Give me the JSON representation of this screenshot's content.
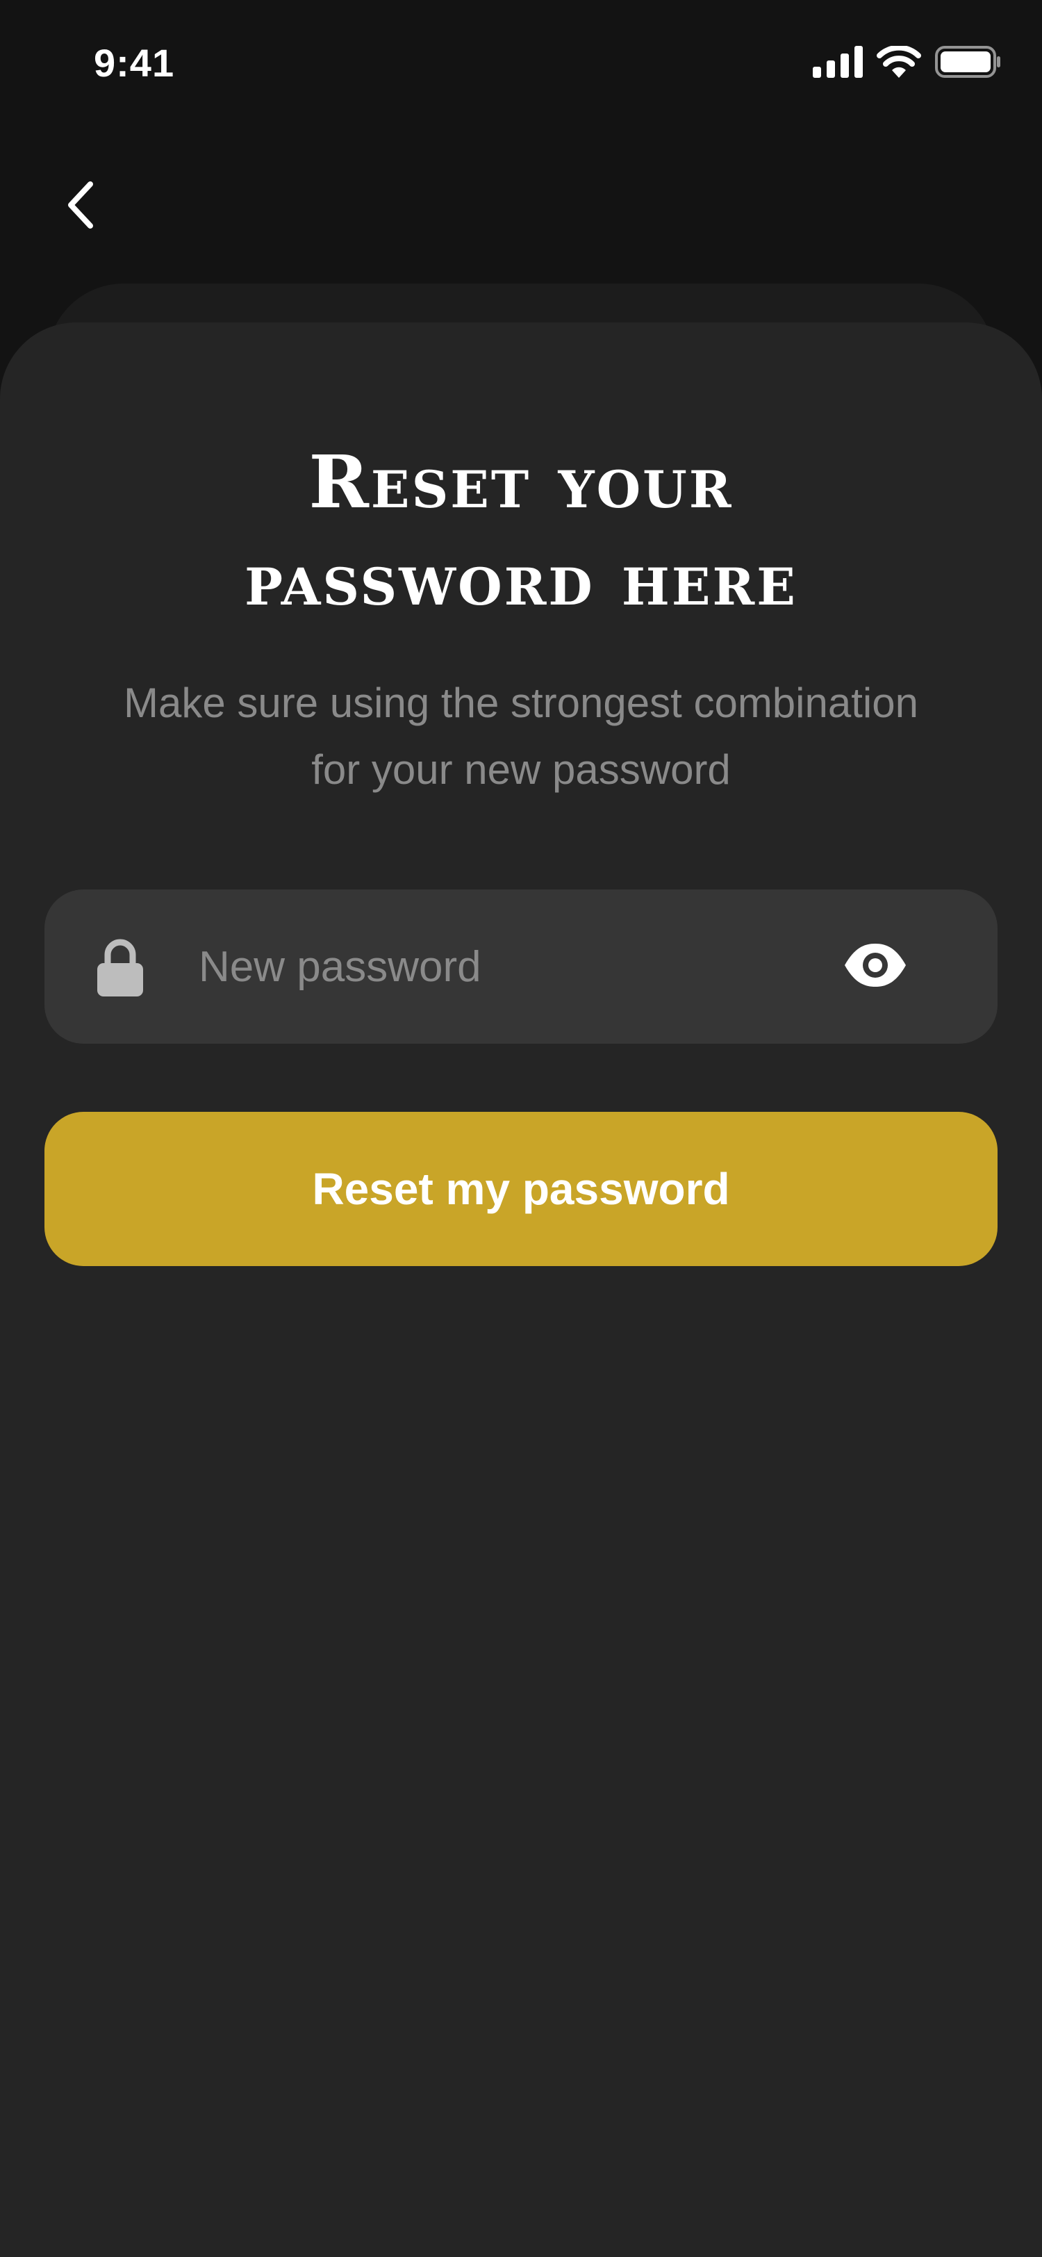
{
  "status_bar": {
    "time": "9:41",
    "icons": [
      "cellular-signal-icon",
      "wifi-icon",
      "battery-icon"
    ]
  },
  "nav": {
    "back_icon": "chevron-left-icon"
  },
  "reset": {
    "title_line1": "Reset your",
    "title_line2": "password here",
    "subtitle_line1": "Make sure using the strongest combination",
    "subtitle_line2": "for your new password",
    "password_field": {
      "placeholder": "New password",
      "value": "",
      "leading_icon": "lock-icon",
      "trailing_icon": "eye-icon"
    },
    "submit_label": "Reset my password"
  },
  "colors": {
    "background": "#131313",
    "sheet": "#252525",
    "field": "#363636",
    "accent": "#c9a528",
    "muted_text": "#8a8a8a",
    "text": "#ffffff"
  }
}
